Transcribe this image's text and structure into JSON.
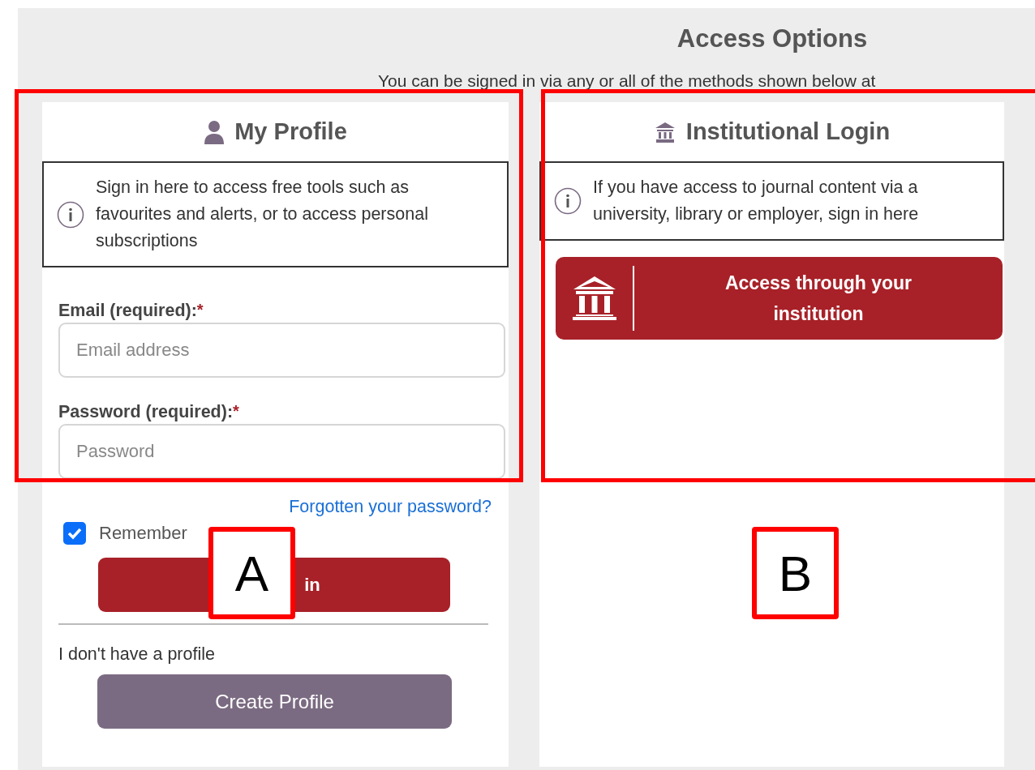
{
  "page": {
    "title": "Access Options",
    "subtitle": "You can be signed in via any or all of the methods shown below at"
  },
  "profile_panel": {
    "title": "My Profile",
    "info": "Sign in here to access free tools such as favourites and alerts, or to access personal subscriptions",
    "fields": [
      {
        "label": "Email (required):",
        "required_mark": "*",
        "placeholder": "Email address"
      },
      {
        "label": "Password (required):",
        "required_mark": "*",
        "placeholder": "Password"
      }
    ],
    "forgot_link": "Forgotten your password?",
    "remember": {
      "label": "Remember",
      "checked": true
    },
    "sign_in_button": "in",
    "no_profile_text": "I don't have a profile",
    "create_button": "Create Profile"
  },
  "institution_panel": {
    "title": "Institutional Login",
    "info": "If you have access to journal content via a university, library or employer, sign in here",
    "access_button": "Access through your institution"
  },
  "annotations": [
    {
      "label": "A"
    },
    {
      "label": "B"
    }
  ]
}
